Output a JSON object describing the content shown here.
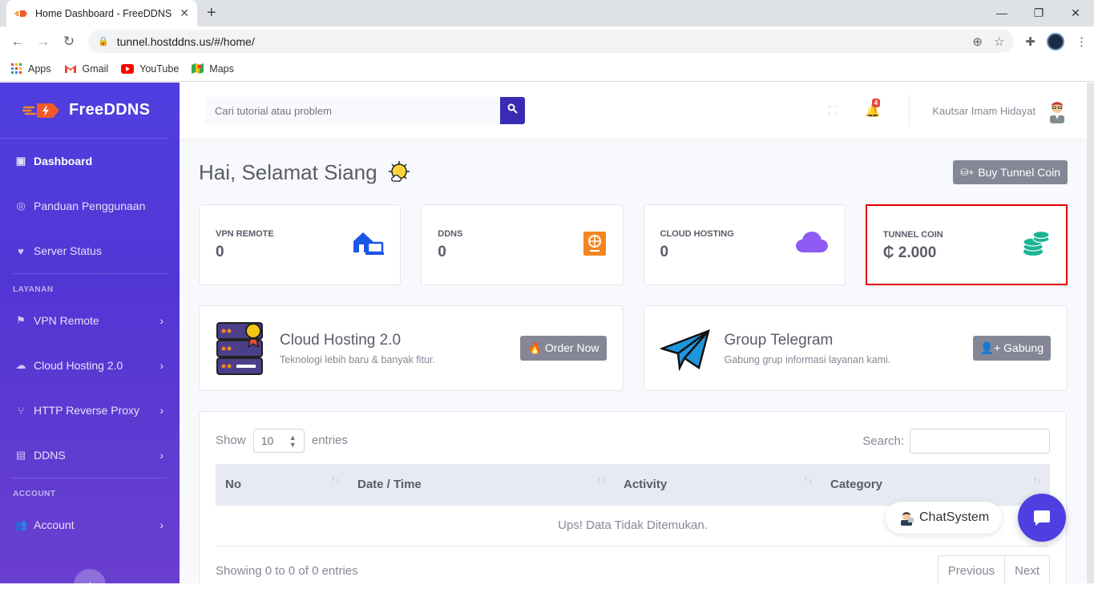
{
  "browser": {
    "tab_title": "Home Dashboard - FreeDDNS Tu",
    "tab_close": "✕",
    "new_tab": "+",
    "window_controls": [
      "—",
      "❐",
      "✕"
    ],
    "url": "tunnel.hostddns.us/#/home/",
    "bookmarks": [
      {
        "label": "Apps",
        "icon": "apps-grid-icon"
      },
      {
        "label": "Gmail",
        "icon": "gmail-icon"
      },
      {
        "label": "YouTube",
        "icon": "youtube-icon"
      },
      {
        "label": "Maps",
        "icon": "maps-icon"
      }
    ]
  },
  "sidebar": {
    "brand": "FreeDDNS",
    "items": [
      {
        "label": "Dashboard",
        "icon": "dashboard-icon",
        "active": true
      },
      {
        "label": "Panduan Penggunaan",
        "icon": "globe-icon"
      },
      {
        "label": "Server Status",
        "icon": "heart-icon"
      }
    ],
    "section_layanan": "LAYANAN",
    "layanan_items": [
      {
        "label": "VPN Remote",
        "icon": "network-icon"
      },
      {
        "label": "Cloud Hosting 2.0",
        "icon": "cloud-icon"
      },
      {
        "label": "HTTP Reverse Proxy",
        "icon": "proxy-icon"
      },
      {
        "label": "DDNS",
        "icon": "book-icon"
      }
    ],
    "section_account": "ACCOUNT",
    "account_items": [
      {
        "label": "Account",
        "icon": "users-icon"
      }
    ]
  },
  "topbar": {
    "search_placeholder": "Cari tutorial atau problem",
    "notification_count": "4",
    "user_name": "Kautsar Imam Hidayat"
  },
  "page": {
    "greeting": "Hai, Selamat Siang",
    "buy_button": "Buy Tunnel Coin"
  },
  "stats": [
    {
      "label": "VPN REMOTE",
      "value": "0",
      "icon": "home-network-icon",
      "color": "#1a56e8"
    },
    {
      "label": "DDNS",
      "value": "0",
      "icon": "passport-icon",
      "color": "#f5861f"
    },
    {
      "label": "CLOUD HOSTING",
      "value": "0",
      "icon": "cloud-icon",
      "color": "#8e5cf5"
    },
    {
      "label": "TUNNEL COIN",
      "value": "₵ 2.000",
      "icon": "coins-icon",
      "color": "#1ab394"
    }
  ],
  "promos": [
    {
      "title": "Cloud Hosting 2.0",
      "subtitle": "Teknologi lebih baru & banyak fitur.",
      "button": "Order Now",
      "icon": "server-icon"
    },
    {
      "title": "Group Telegram",
      "subtitle": "Gabung grup informasi layanan kami.",
      "button": "Gabung",
      "icon": "telegram-icon"
    }
  ],
  "table": {
    "show_label": "Show",
    "entries_value": "10",
    "entries_label": "entries",
    "search_label": "Search:",
    "columns": [
      "No",
      "Date / Time",
      "Activity",
      "Category"
    ],
    "empty_message": "Ups! Data Tidak Ditemukan.",
    "info": "Showing 0 to 0 of 0 entries",
    "prev": "Previous",
    "next": "Next"
  },
  "chat": {
    "label": "ChatSystem"
  }
}
